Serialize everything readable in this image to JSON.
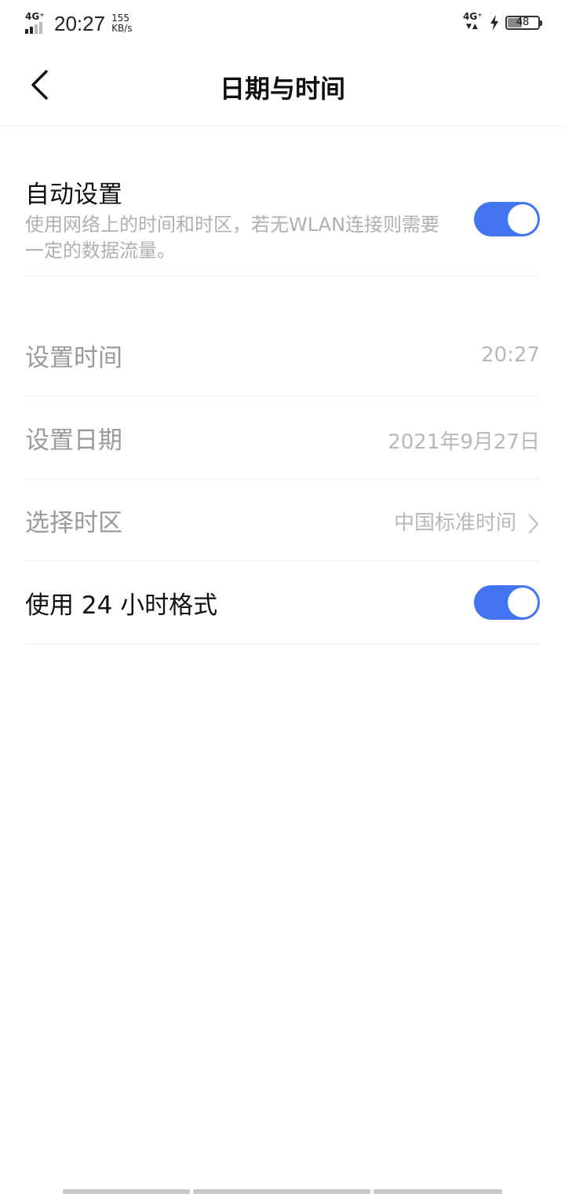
{
  "status_bar": {
    "network_left": "4G⁺",
    "time": "20:27",
    "speed_value": "155",
    "speed_unit": "KB/s",
    "network_right": "4G⁺",
    "battery": "48",
    "battery_level": 0.48
  },
  "header": {
    "title": "日期与时间"
  },
  "auto_setting": {
    "title": "自动设置",
    "description": "使用网络上的时间和时区，若无WLAN连接则需要一定的数据流量。",
    "enabled": true
  },
  "set_time": {
    "label": "设置时间",
    "value": "20:27"
  },
  "set_date": {
    "label": "设置日期",
    "value": "2021年9月27日"
  },
  "timezone": {
    "label": "选择时区",
    "value": "中国标准时间"
  },
  "format_24h": {
    "label": "使用 24 小时格式",
    "enabled": true
  },
  "colors": {
    "accent": "#4374f2",
    "disabled_text": "#9a9a9a",
    "secondary_text": "#b0b0b0"
  }
}
